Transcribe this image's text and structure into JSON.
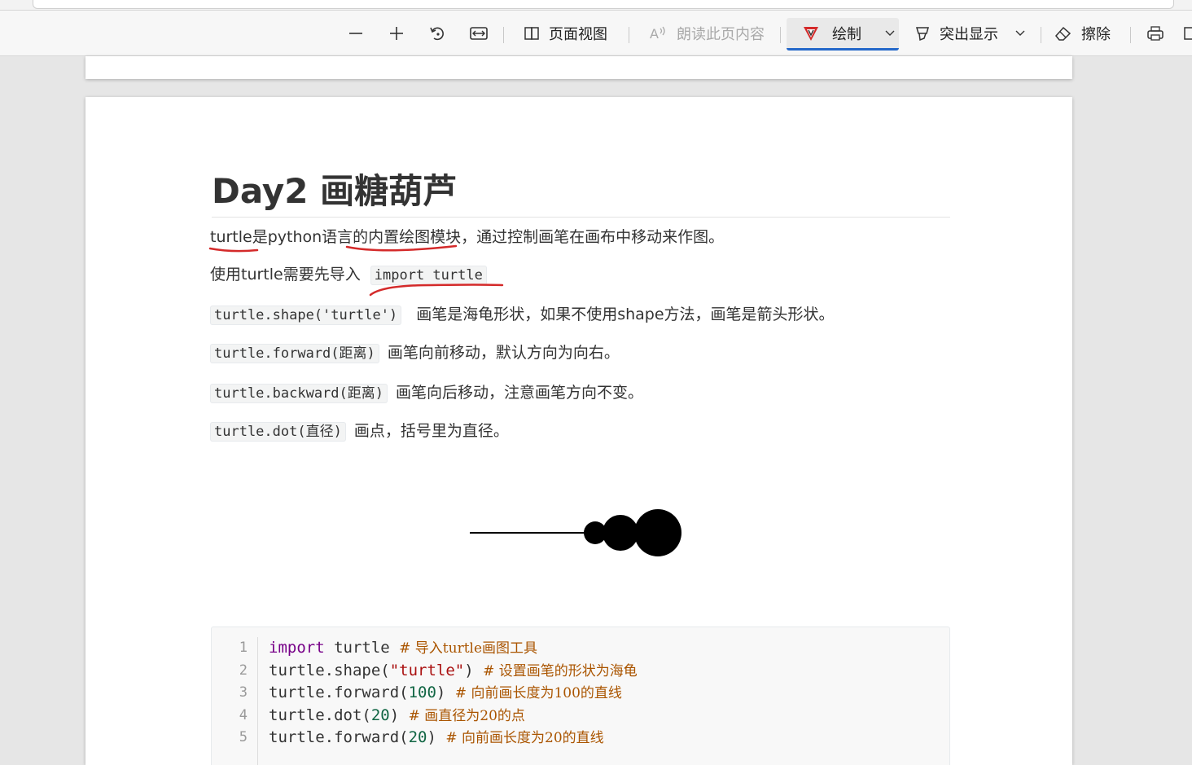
{
  "toolbar": {
    "zoom_out_icon": "minus-icon",
    "zoom_in_icon": "plus-icon",
    "rotate_icon": "rotate-icon",
    "fit_icon": "fit-width-icon",
    "page_view_label": "页面视图",
    "read_aloud_label": "朗读此页内容",
    "draw_label": "绘制",
    "highlight_label": "突出显示",
    "erase_label": "擦除",
    "print_icon": "printer-icon",
    "accent_color": "#2468c9",
    "draw_color": "#d42a2a"
  },
  "doc": {
    "title": "Day2 画糖葫芦",
    "p1": "turtle是python语言的内置绘图模块，通过控制画笔在画布中移动来作图。",
    "p2_text": "使用turtle需要先导入",
    "p2_code": "import turtle",
    "p3_code": "turtle.shape('turtle')",
    "p3_text": "画笔是海龟形状，如果不使用shape方法，画笔是箭头形状。",
    "p4_code": "turtle.forward(距离)",
    "p4_text": "画笔向前移动，默认方向为向右。",
    "p5_code": "turtle.backward(距离)",
    "p5_text": "画笔向后移动，注意画笔方向不变。",
    "p6_code": "turtle.dot(直径)",
    "p6_text": "画点，括号里为直径。"
  },
  "code": {
    "line_numbers": [
      "1",
      "2",
      "3",
      "4",
      "5"
    ],
    "l1_kw": "import",
    "l1_rest": " turtle ",
    "l1_cm": "# 导入turtle画图工具",
    "l2_a": "turtle.shape(",
    "l2_str": "\"turtle\"",
    "l2_b": ") ",
    "l2_cm": "# 设置画笔的形状为海龟",
    "l3_a": "turtle.forward(",
    "l3_num": "100",
    "l3_b": ") ",
    "l3_cm": "# 向前画长度为100的直线",
    "l4_a": "turtle.dot(",
    "l4_num": "20",
    "l4_b": ") ",
    "l4_cm": "# 画直径为20的点",
    "l5_a": "turtle.forward(",
    "l5_num": "20",
    "l5_b": ") ",
    "l5_cm": "# 向前画长度为20的直线"
  }
}
